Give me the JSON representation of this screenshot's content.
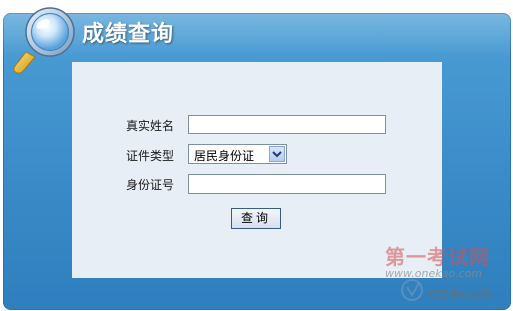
{
  "header": {
    "title": "成绩查询"
  },
  "form": {
    "name_label": "真实姓名",
    "name_value": "",
    "idtype_label": "证件类型",
    "idtype_selected": "居民身份证",
    "idnum_label": "身份证号",
    "idnum_value": "",
    "submit_label": "查询"
  },
  "watermark": {
    "brand": "第一考试网",
    "url": "www.onekao.com",
    "slogan": "祝您考试成功"
  },
  "colors": {
    "panel_blue": "#3a8bc8",
    "content_bg": "#e7eef5",
    "watermark_red": "#d65050"
  },
  "icons": [
    "magnifier-icon",
    "dropdown-arrow-icon",
    "watermark-logo-icon"
  ]
}
